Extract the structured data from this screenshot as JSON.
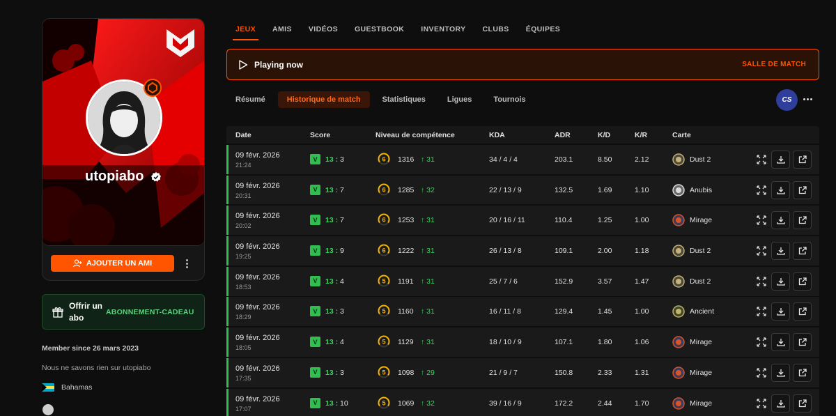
{
  "profile": {
    "username": "utopiabo",
    "add_friend_label": "AJOUTER UN AMI",
    "gift_title": "Offrir un abo",
    "gift_link": "ABONNEMENT-CADEAU",
    "member_since": "Member since 26 mars 2023",
    "bio": "Nous ne savons rien sur utopiabo",
    "country": "Bahamas"
  },
  "tabs": [
    "JEUX",
    "AMIS",
    "VIDÉOS",
    "GUESTBOOK",
    "INVENTORY",
    "CLUBS",
    "ÉQUIPES"
  ],
  "active_tab": "JEUX",
  "playing": {
    "label": "Playing now",
    "action": "SALLE DE MATCH"
  },
  "subtabs": [
    "Résumé",
    "Historique de match",
    "Statistiques",
    "Ligues",
    "Tournois"
  ],
  "active_subtab": "Historique de match",
  "game_logo": "CS",
  "table": {
    "headers": [
      "Date",
      "Score",
      "Niveau de compétence",
      "KDA",
      "ADR",
      "K/D",
      "K/R",
      "Carte"
    ],
    "rows": [
      {
        "date": "09 févr. 2026",
        "time": "21:24",
        "result": "V",
        "score_win": "13",
        "score_loss": "3",
        "level": "6",
        "elo": "1316",
        "gain": "31",
        "kda": "34 / 4 / 4",
        "adr": "203.1",
        "kd": "8.50",
        "kr": "2.12",
        "map": "Dust 2"
      },
      {
        "date": "09 févr. 2026",
        "time": "20:31",
        "result": "V",
        "score_win": "13",
        "score_loss": "7",
        "level": "6",
        "elo": "1285",
        "gain": "32",
        "kda": "22 / 13 / 9",
        "adr": "132.5",
        "kd": "1.69",
        "kr": "1.10",
        "map": "Anubis"
      },
      {
        "date": "09 févr. 2026",
        "time": "20:02",
        "result": "V",
        "score_win": "13",
        "score_loss": "7",
        "level": "6",
        "elo": "1253",
        "gain": "31",
        "kda": "20 / 16 / 11",
        "adr": "110.4",
        "kd": "1.25",
        "kr": "1.00",
        "map": "Mirage"
      },
      {
        "date": "09 févr. 2026",
        "time": "19:25",
        "result": "V",
        "score_win": "13",
        "score_loss": "9",
        "level": "6",
        "elo": "1222",
        "gain": "31",
        "kda": "26 / 13 / 8",
        "adr": "109.1",
        "kd": "2.00",
        "kr": "1.18",
        "map": "Dust 2"
      },
      {
        "date": "09 févr. 2026",
        "time": "18:53",
        "result": "V",
        "score_win": "13",
        "score_loss": "4",
        "level": "5",
        "elo": "1191",
        "gain": "31",
        "kda": "25 / 7 / 6",
        "adr": "152.9",
        "kd": "3.57",
        "kr": "1.47",
        "map": "Dust 2"
      },
      {
        "date": "09 févr. 2026",
        "time": "18:29",
        "result": "V",
        "score_win": "13",
        "score_loss": "3",
        "level": "5",
        "elo": "1160",
        "gain": "31",
        "kda": "16 / 11 / 8",
        "adr": "129.4",
        "kd": "1.45",
        "kr": "1.00",
        "map": "Ancient"
      },
      {
        "date": "09 févr. 2026",
        "time": "18:05",
        "result": "V",
        "score_win": "13",
        "score_loss": "4",
        "level": "5",
        "elo": "1129",
        "gain": "31",
        "kda": "18 / 10 / 9",
        "adr": "107.1",
        "kd": "1.80",
        "kr": "1.06",
        "map": "Mirage"
      },
      {
        "date": "09 févr. 2026",
        "time": "17:35",
        "result": "V",
        "score_win": "13",
        "score_loss": "3",
        "level": "5",
        "elo": "1098",
        "gain": "29",
        "kda": "21 / 9 / 7",
        "adr": "150.8",
        "kd": "2.33",
        "kr": "1.31",
        "map": "Mirage"
      },
      {
        "date": "09 févr. 2026",
        "time": "17:07",
        "result": "V",
        "score_win": "13",
        "score_loss": "10",
        "level": "5",
        "elo": "1069",
        "gain": "32",
        "kda": "39 / 16 / 9",
        "adr": "172.2",
        "kd": "2.44",
        "kr": "1.70",
        "map": "Mirage"
      }
    ]
  },
  "colors": {
    "accent": "#ff5500",
    "win": "#2fbf4f",
    "level_ring": "#f5b400",
    "background": "#0e0e0e"
  },
  "icons": [
    "mouz-logo-icon",
    "verified-icon",
    "add-person-icon",
    "gift-icon",
    "play-icon",
    "expand-icon",
    "download-icon",
    "external-link-icon",
    "steam-icon",
    "bahamas-flag-icon"
  ]
}
